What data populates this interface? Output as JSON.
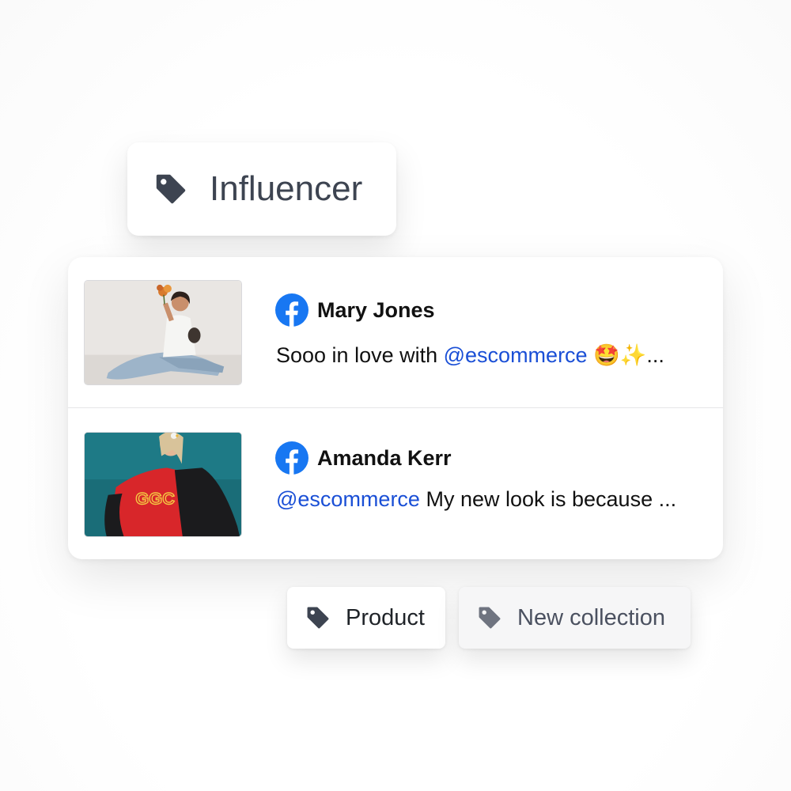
{
  "tags": {
    "influencer": {
      "label": "Influencer",
      "icon": "tag-icon"
    },
    "product": {
      "label": "Product",
      "icon": "tag-icon"
    },
    "new_collection": {
      "label": "New collection",
      "icon": "tag-icon"
    }
  },
  "posts": [
    {
      "network_icon": "facebook-icon",
      "author": "Mary Jones",
      "mention": "@escommerce",
      "text_before": "Sooo in love with ",
      "text_after": " 🤩✨...",
      "image": "photo-woman-with-flowers"
    },
    {
      "network_icon": "facebook-icon",
      "author": "Amanda Kerr",
      "mention": "@escommerce",
      "text_before": "",
      "text_after": " My new look is because ...",
      "image": "photo-woman-red-shirt"
    }
  ],
  "colors": {
    "tag_text": "#3d4451",
    "mention": "#1a4fd6",
    "facebook": "#1877f2"
  }
}
